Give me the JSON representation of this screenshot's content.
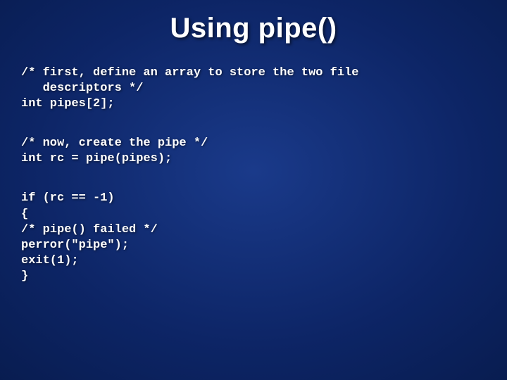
{
  "title": "Using pipe()",
  "blocks": [
    "/* first, define an array to store the two file\n   descriptors */\nint pipes[2];",
    "/* now, create the pipe */\nint rc = pipe(pipes);",
    "if (rc == -1)\n{\n/* pipe() failed */\nperror(\"pipe\");\nexit(1);\n}"
  ]
}
